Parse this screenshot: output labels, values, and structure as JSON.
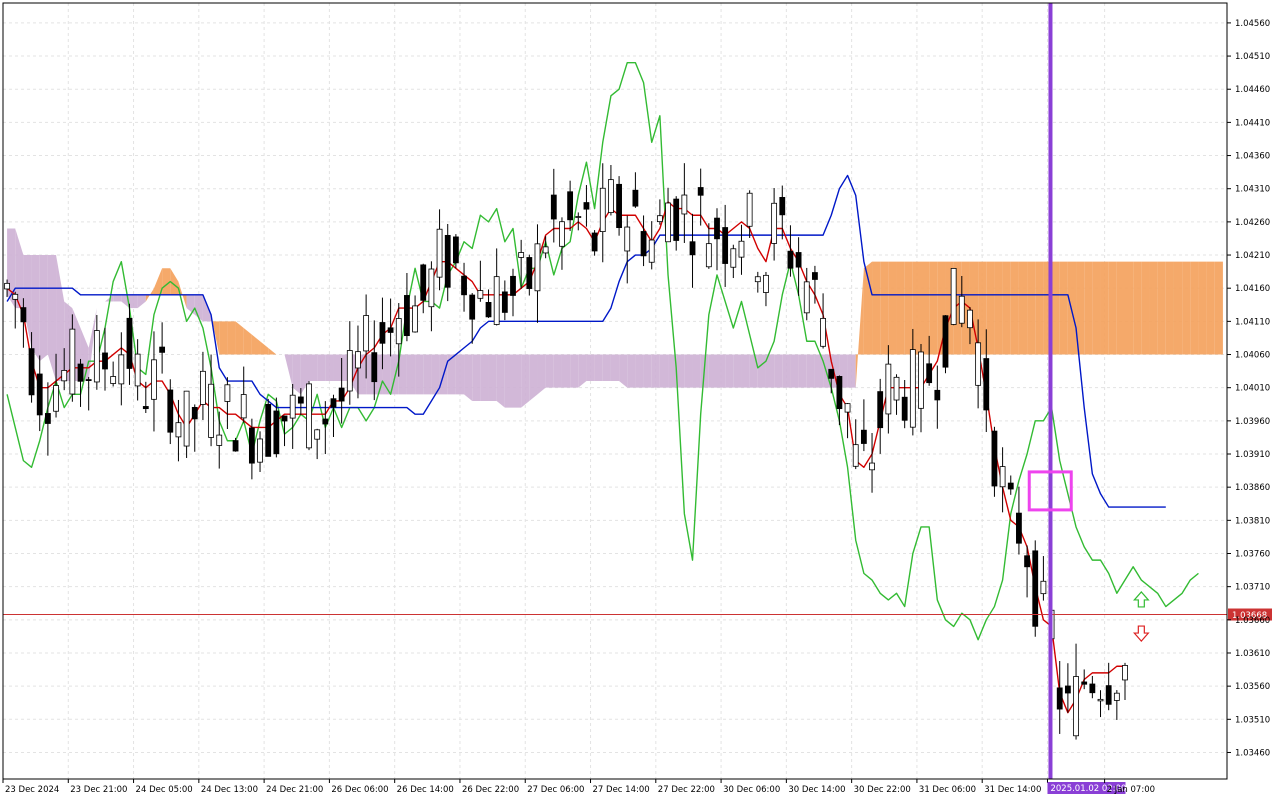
{
  "chart_data": {
    "type": "candlestick",
    "symbol": "",
    "timeframe": "H1",
    "ylim": [
      1.0342,
      1.0459
    ],
    "y_ticks": [
      "1.04560",
      "1.04510",
      "1.04460",
      "1.04410",
      "1.04360",
      "1.04310",
      "1.04260",
      "1.04210",
      "1.04160",
      "1.04110",
      "1.04060",
      "1.04010",
      "1.03960",
      "1.03910",
      "1.03860",
      "1.03810",
      "1.03760",
      "1.03710",
      "1.03660",
      "1.03610",
      "1.03560",
      "1.03510",
      "1.03460"
    ],
    "x_ticks": [
      "23 Dec 2024",
      "23 Dec 21:00",
      "24 Dec 05:00",
      "24 Dec 13:00",
      "24 Dec 21:00",
      "26 Dec 06:00",
      "26 Dec 14:00",
      "26 Dec 22:00",
      "27 Dec 06:00",
      "27 Dec 14:00",
      "27 Dec 22:00",
      "30 Dec 06:00",
      "30 Dec 14:00",
      "30 Dec 22:00",
      "31 Dec 06:00",
      "31 Dec 14:00",
      "2025.01.02 02:00",
      "2 Jan 07:00"
    ],
    "x_highlight": "2025.01.02 02:00",
    "current_price": 1.03668,
    "current_price_label": "1.03668",
    "grid": true,
    "colors": {
      "bull_body": "#ffffff",
      "bear_body": "#000000",
      "highlight_candle": "#1f5fa8",
      "tenkan": "#d10000",
      "kijun": "#0018c8",
      "chikou": "#33bb33",
      "kumo_bull": "#f4a05a",
      "kumo_bear": "#cdb0d4",
      "signal_line": "#8a3fd6",
      "marker_box": "#ee44ee",
      "price_line": "#cc3333",
      "up_arrow": "#33bb33",
      "down_arrow": "#dd2222"
    },
    "series_tenkan": [
      1.0416,
      1.0415,
      1.0412,
      1.0405,
      1.0401,
      1.0401,
      1.0402,
      1.0403,
      1.0404,
      1.0404,
      1.0404,
      1.0405,
      1.0405,
      1.0406,
      1.0407,
      1.0406,
      1.0402,
      1.0401,
      1.0402,
      1.0402,
      1.04,
      1.0397,
      1.0395,
      1.0397,
      1.0399,
      1.0398,
      1.0398,
      1.0397,
      1.0397,
      1.0396,
      1.0395,
      1.0395,
      1.0395,
      1.0396,
      1.0397,
      1.0397,
      1.0397,
      1.0397,
      1.0397,
      1.0397,
      1.0399,
      1.0399,
      1.0401,
      1.0404,
      1.0406,
      1.0407,
      1.0409,
      1.041,
      1.0413,
      1.0413,
      1.0413,
      1.0414,
      1.0417,
      1.042,
      1.042,
      1.0419,
      1.0418,
      1.0417,
      1.0415,
      1.0415,
      1.0415,
      1.0415,
      1.0415,
      1.0416,
      1.0417,
      1.042,
      1.0424,
      1.0425,
      1.0425,
      1.0425,
      1.0426,
      1.0425,
      1.0423,
      1.0426,
      1.0428,
      1.0427,
      1.0427,
      1.0427,
      1.0425,
      1.0423,
      1.0425,
      1.0429,
      1.0428,
      1.0428,
      1.0427,
      1.0427,
      1.0425,
      1.0425,
      1.0424,
      1.0425,
      1.0426,
      1.0425,
      1.0422,
      1.042,
      1.0425,
      1.0425,
      1.0422,
      1.042,
      1.0417,
      1.0415,
      1.0412,
      1.0405,
      1.04,
      1.0398,
      1.039,
      1.0389,
      1.0391,
      1.0396,
      1.0401,
      1.0401,
      1.0401,
      1.0401,
      1.0401,
      1.0403,
      1.0405,
      1.041,
      1.0413,
      1.0414,
      1.0413,
      1.0407,
      1.04,
      1.0392,
      1.0386,
      1.0381,
      1.038,
      1.0377,
      1.0371,
      1.0366,
      1.0365,
      1.0355,
      1.0352,
      1.0354,
      1.0357,
      1.0358,
      1.0358,
      1.0358,
      1.0359,
      1.0359
    ],
    "series_kijun": [
      1.0414,
      1.0416,
      1.0416,
      1.0416,
      1.0416,
      1.0416,
      1.0416,
      1.0416,
      1.0416,
      1.0415,
      1.0415,
      1.0415,
      1.0415,
      1.0415,
      1.0415,
      1.0415,
      1.0415,
      1.0415,
      1.0415,
      1.0415,
      1.0415,
      1.0415,
      1.0415,
      1.0415,
      1.0415,
      1.0412,
      1.0404,
      1.0402,
      1.0402,
      1.0402,
      1.0402,
      1.04,
      1.0399,
      1.0398,
      1.0398,
      1.0398,
      1.0398,
      1.0398,
      1.0398,
      1.0398,
      1.0398,
      1.0398,
      1.0398,
      1.0398,
      1.0398,
      1.0398,
      1.0398,
      1.0398,
      1.0398,
      1.0398,
      1.0397,
      1.0397,
      1.0399,
      1.0401,
      1.0405,
      1.0406,
      1.0407,
      1.0408,
      1.041,
      1.0411,
      1.0411,
      1.0411,
      1.0411,
      1.0411,
      1.0411,
      1.0411,
      1.0411,
      1.0411,
      1.0411,
      1.0411,
      1.0411,
      1.0411,
      1.0411,
      1.0411,
      1.0413,
      1.0417,
      1.042,
      1.0421,
      1.0421,
      1.0422,
      1.0424,
      1.0424,
      1.0424,
      1.0424,
      1.0424,
      1.0424,
      1.0424,
      1.0424,
      1.0424,
      1.0424,
      1.0424,
      1.0424,
      1.0424,
      1.0424,
      1.0424,
      1.0424,
      1.0424,
      1.0424,
      1.0424,
      1.0424,
      1.0424,
      1.0427,
      1.0431,
      1.0433,
      1.043,
      1.042,
      1.0415,
      1.0415,
      1.0415,
      1.0415,
      1.0415,
      1.0415,
      1.0415,
      1.0415,
      1.0415,
      1.0415,
      1.0415,
      1.0415,
      1.0415,
      1.0415,
      1.0415,
      1.0415,
      1.0415,
      1.0415,
      1.0415,
      1.0415,
      1.0415,
      1.0415,
      1.0415,
      1.0415,
      1.0415,
      1.041,
      1.0398,
      1.0388,
      1.0385,
      1.0383,
      1.0383,
      1.0383,
      1.0383,
      1.0383,
      1.0383,
      1.0383,
      1.0383
    ],
    "series_chikou": [
      1.04,
      1.0395,
      1.039,
      1.0389,
      1.0393,
      1.0398,
      1.0402,
      1.0398,
      1.04,
      1.04,
      1.0405,
      1.0405,
      1.041,
      1.0417,
      1.042,
      1.0413,
      1.0404,
      1.0403,
      1.0412,
      1.0416,
      1.0417,
      1.0416,
      1.0411,
      1.0413,
      1.041,
      1.0404,
      1.0396,
      1.0393,
      1.0393,
      1.0396,
      1.0391,
      1.0396,
      1.04,
      1.0399,
      1.0394,
      1.0395,
      1.0397,
      1.0396,
      1.04,
      1.0395,
      1.0398,
      1.0395,
      1.0398,
      1.0398,
      1.0396,
      1.0398,
      1.0402,
      1.04,
      1.0405,
      1.0413,
      1.0419,
      1.0414,
      1.0414,
      1.0413,
      1.0418,
      1.042,
      1.0423,
      1.0422,
      1.0427,
      1.0426,
      1.0428,
      1.0423,
      1.0425,
      1.0416,
      1.0419,
      1.0419,
      1.0423,
      1.0418,
      1.0422,
      1.0423,
      1.043,
      1.0435,
      1.0428,
      1.0438,
      1.0445,
      1.0446,
      1.045,
      1.045,
      1.0447,
      1.0438,
      1.0442,
      1.0418,
      1.0404,
      1.0382,
      1.0375,
      1.0397,
      1.0412,
      1.0418,
      1.0414,
      1.041,
      1.0414,
      1.0409,
      1.0404,
      1.0405,
      1.0408,
      1.0415,
      1.042,
      1.0415,
      1.0408,
      1.0408,
      1.0405,
      1.0401,
      1.0396,
      1.0389,
      1.0378,
      1.0373,
      1.0372,
      1.037,
      1.0369,
      1.037,
      1.0368,
      1.0376,
      1.038,
      1.038,
      1.0369,
      1.0366,
      1.0365,
      1.0367,
      1.0366,
      1.0363,
      1.0366,
      1.0368,
      1.0372,
      1.0382,
      1.0387,
      1.0391,
      1.0396,
      1.0396,
      1.0398,
      1.039,
      1.0385,
      1.038,
      1.0377,
      1.0375,
      1.0375,
      1.0373,
      1.037,
      1.0372,
      1.0374,
      1.0372,
      1.0371,
      1.037,
      1.0368,
      1.0369,
      1.037,
      1.0372,
      1.0373
    ],
    "cloud_span_a": [
      1.0415,
      1.0413,
      1.0413,
      1.0407,
      1.0405,
      1.0406,
      1.0402,
      1.0402,
      1.0402,
      1.0402,
      1.0402,
      1.0413,
      1.0414,
      1.0414,
      1.0414,
      1.0413,
      1.0413,
      1.0414,
      1.0416,
      1.0419,
      1.0419,
      1.0417,
      1.0413,
      1.0412,
      1.0411,
      1.0411,
      1.0411,
      1.0411,
      1.0411,
      1.041,
      1.0409,
      1.0408,
      1.0407,
      1.0406,
      1.0406,
      1.0401,
      1.04,
      1.0402,
      1.0402,
      1.0402,
      1.0402,
      1.0402,
      1.0402,
      1.04,
      1.04,
      1.04,
      1.04,
      1.04,
      1.04,
      1.04,
      1.04,
      1.04,
      1.04,
      1.04,
      1.04,
      1.04,
      1.04,
      1.0399,
      1.0399,
      1.0399,
      1.0399,
      1.0398,
      1.0398,
      1.0398,
      1.0399,
      1.04,
      1.0401,
      1.0401,
      1.0401,
      1.0401,
      1.0401,
      1.0402,
      1.0402,
      1.0402,
      1.0402,
      1.0402,
      1.0401,
      1.0401,
      1.0401,
      1.0401,
      1.0401,
      1.0401,
      1.0401,
      1.0401,
      1.0401,
      1.0401,
      1.0401,
      1.0401,
      1.0401,
      1.0401,
      1.0401,
      1.0401,
      1.0401,
      1.0401,
      1.0401,
      1.0401,
      1.0401,
      1.0401,
      1.0401,
      1.0401,
      1.0401,
      1.0401,
      1.0401,
      1.0401,
      1.0401,
      1.0419,
      1.042,
      1.042,
      1.042,
      1.042,
      1.042,
      1.042,
      1.042,
      1.042,
      1.042,
      1.042,
      1.042,
      1.042,
      1.042,
      1.042,
      1.042,
      1.042,
      1.042,
      1.042,
      1.042,
      1.042,
      1.042,
      1.042,
      1.042,
      1.042,
      1.042,
      1.042,
      1.042,
      1.042,
      1.042,
      1.042,
      1.042,
      1.042,
      1.042,
      1.042,
      1.042,
      1.042,
      1.042,
      1.042,
      1.042,
      1.042,
      1.042,
      1.042,
      1.042,
      1.042,
      1.042,
      1.042,
      1.042,
      1.042,
      1.042,
      1.042
    ],
    "cloud_span_b": [
      1.0425,
      1.0425,
      1.0421,
      1.0421,
      1.0421,
      1.0421,
      1.0421,
      1.0414,
      1.0413,
      1.041,
      1.0407,
      1.0413,
      1.0414,
      1.0415,
      1.0415,
      1.0415,
      1.0415,
      1.0415,
      1.0415,
      1.0415,
      1.0415,
      1.0415,
      1.0415,
      1.0415,
      1.0415,
      1.0412,
      1.0406,
      1.0406,
      1.0406,
      1.0406,
      1.0406,
      1.0406,
      1.0406,
      1.0406,
      1.0406,
      1.0406,
      1.0406,
      1.0406,
      1.0406,
      1.0406,
      1.0406,
      1.0406,
      1.0406,
      1.0406,
      1.0406,
      1.0406,
      1.0406,
      1.0406,
      1.0406,
      1.0406,
      1.0406,
      1.0406,
      1.0406,
      1.0406,
      1.0406,
      1.0406,
      1.0406,
      1.0406,
      1.0406,
      1.0406,
      1.0406,
      1.0406,
      1.0406,
      1.0406,
      1.0406,
      1.0406,
      1.0406,
      1.0406,
      1.0406,
      1.0406,
      1.0406,
      1.0406,
      1.0406,
      1.0406,
      1.0406,
      1.0406,
      1.0406,
      1.0406,
      1.0406,
      1.0406,
      1.0406,
      1.0406,
      1.0406,
      1.0406,
      1.0406,
      1.0406,
      1.0406,
      1.0406,
      1.0406,
      1.0406,
      1.0406,
      1.0406,
      1.0406,
      1.0406,
      1.0406,
      1.0406,
      1.0406,
      1.0406,
      1.0406,
      1.0406,
      1.0406,
      1.0406,
      1.0406,
      1.0406,
      1.0406,
      1.0406,
      1.0406,
      1.0406,
      1.0406,
      1.0406,
      1.0406,
      1.0406,
      1.0406,
      1.0406,
      1.0406,
      1.0406,
      1.0406,
      1.0406,
      1.0406,
      1.0406,
      1.0406,
      1.0406,
      1.0406,
      1.0406,
      1.0406,
      1.0406,
      1.0406,
      1.0406,
      1.0406,
      1.0406,
      1.0406,
      1.0406,
      1.0406,
      1.0406,
      1.0406,
      1.0406,
      1.0406,
      1.0406,
      1.0406,
      1.0406,
      1.0406,
      1.0406,
      1.0406,
      1.0406,
      1.0406,
      1.0406,
      1.0406,
      1.0406,
      1.0406,
      1.0406,
      1.0406,
      1.0406,
      1.0406,
      1.0406,
      1.0406,
      1.0406,
      1.0406
    ]
  }
}
